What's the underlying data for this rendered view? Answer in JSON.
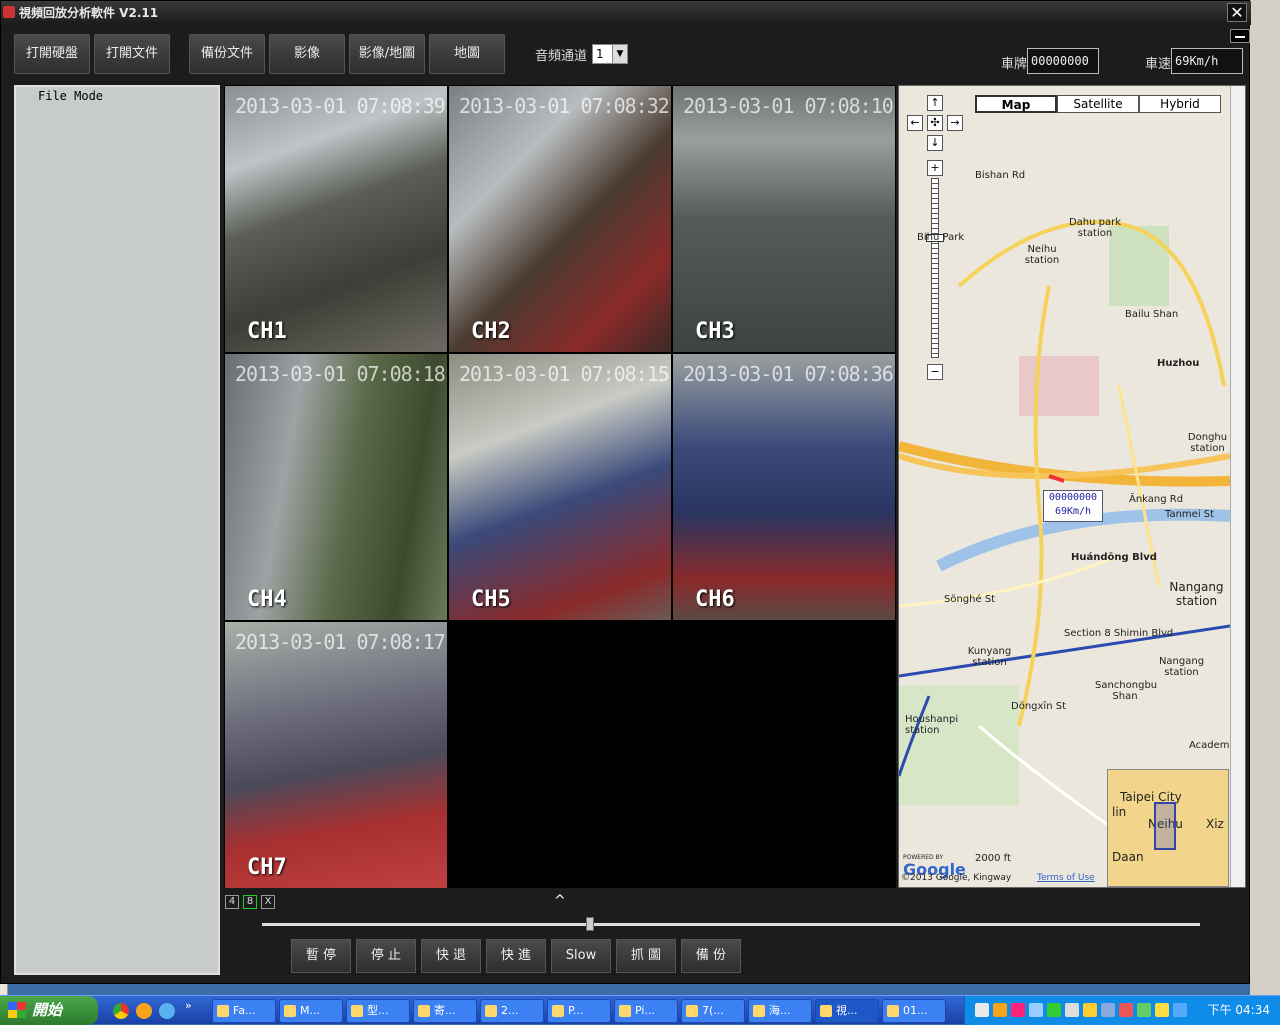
{
  "window": {
    "title": "視頻回放分析軟件 V2.11",
    "close": "✕"
  },
  "toolbar": {
    "buttons": [
      "打開硬盤",
      "打開文件",
      "備份文件",
      "影像",
      "影像/地圖",
      "地圖"
    ],
    "audio_label": "音頻通道",
    "audio_value": "1",
    "plate_label": "車牌",
    "plate_value": "00000000",
    "speed_label": "車速",
    "speed_value": "69Km/h"
  },
  "file_panel": {
    "mode": "File Mode"
  },
  "channels": [
    {
      "label": "CH1",
      "timestamp": "2013-03-01 07:08:39"
    },
    {
      "label": "CH2",
      "timestamp": "2013-03-01 07:08:32"
    },
    {
      "label": "CH3",
      "timestamp": "2013-03-01 07:08:10"
    },
    {
      "label": "CH4",
      "timestamp": "2013-03-01 07:08:18"
    },
    {
      "label": "CH5",
      "timestamp": "2013-03-01 07:08:15"
    },
    {
      "label": "CH6",
      "timestamp": "2013-03-01 07:08:36"
    },
    {
      "label": "CH7",
      "timestamp": "2013-03-01 07:08:17"
    }
  ],
  "map": {
    "types": [
      "Map",
      "Satellite",
      "Hybrid"
    ],
    "marker": {
      "plate": "00000000",
      "speed": "69Km/h"
    },
    "labels": {
      "dahu": "Dahu park station",
      "neihu": "Neihu station",
      "baishan": "Bailu Shan",
      "huzhou": "Huzhou",
      "donghu": "Donghu station",
      "ankang": "Ānkang Rd",
      "tanmei": "Tanmei St",
      "huandong": "Huándōng Blvd",
      "nangang": "Nangang station",
      "nangang2": "Nangang station",
      "kunyang": "Kunyang station",
      "songhe": "Sönghé St",
      "section8": "Section 8 Shimin Blvd",
      "sanchong": "Sanchongbu Shan",
      "houshanpi": "Houshanpi station",
      "dongxing": "Döngxīn St",
      "bihu": "Bihu Park",
      "bishan": "Bishan Rd",
      "park": "Park",
      "academia": "Academi",
      "scale": "2000 ft",
      "terms": "Terms of Use",
      "copyright": "©2013 Google, Kingway",
      "powered": "POWERED BY",
      "google": "Google",
      "taipei": "Taipei City",
      "neihu_ov": "Neihu",
      "daan": "Daan",
      "lin": "lin",
      "xiz": "Xiz"
    }
  },
  "layout_buttons": [
    "4",
    "8",
    "X"
  ],
  "playback": {
    "buttons": [
      "暫 停",
      "停 止",
      "快 退",
      "快 進",
      "Slow",
      "抓 圖",
      "備 份"
    ],
    "position": 0.35
  },
  "taskbar": {
    "start": "開始",
    "tasks": [
      "Fa...",
      "M...",
      "型...",
      "寄...",
      "2...",
      "P...",
      "Pi...",
      "7(...",
      "海...",
      "視...",
      "01..."
    ],
    "clock": "下午 04:34"
  }
}
